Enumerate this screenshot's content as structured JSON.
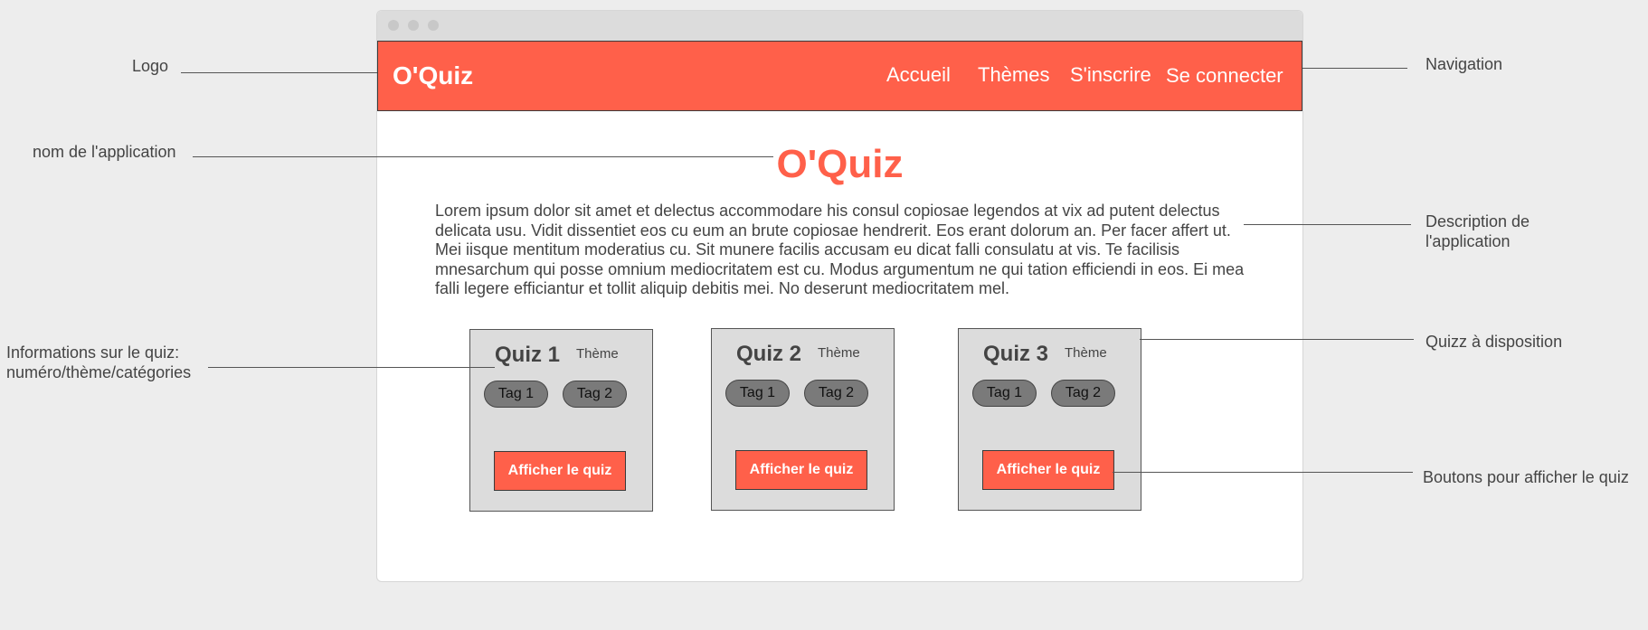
{
  "annotations": {
    "logo": "Logo",
    "app_name": "nom de l'application",
    "quiz_info_line1": "Informations sur le quiz:",
    "quiz_info_line2": "numéro/thème/catégories",
    "navigation": "Navigation",
    "description_line1": "Description de",
    "description_line2": "l'application",
    "quizzes": "Quizz à disposition",
    "buttons": "Boutons pour afficher le quiz"
  },
  "header": {
    "logo": "O'Quiz",
    "nav": [
      "Accueil",
      "Thèmes",
      "S'inscrire",
      "Se connecter"
    ]
  },
  "main": {
    "title": "O'Quiz",
    "description": "Lorem ipsum dolor sit amet et delectus accommodare his consul copiosae legendos at vix ad putent delectus delicata usu. Vidit dissentiet eos cu eum an brute copiosae hendrerit. Eos erant dolorum an. Per facer affert ut. Mei iisque mentitum moderatius cu. Sit munere facilis accusam eu dicat falli consulatu at vis. Te facilisis mnesarchum qui posse omnium mediocritatem est cu. Modus argumentum ne qui tation efficiendi in eos. Ei mea falli legere efficiantur et tollit aliquip debitis mei. No deserunt mediocritatem mel.",
    "quizzes": [
      {
        "title": "Quiz 1",
        "theme": "Thème",
        "tags": [
          "Tag 1",
          "Tag 2"
        ],
        "button": "Afficher le quiz"
      },
      {
        "title": "Quiz 2",
        "theme": "Thème",
        "tags": [
          "Tag 1",
          "Tag 2"
        ],
        "button": "Afficher le quiz"
      },
      {
        "title": "Quiz 3",
        "theme": "Thème",
        "tags": [
          "Tag 1",
          "Tag 2"
        ],
        "button": "Afficher le quiz"
      }
    ]
  },
  "colors": {
    "accent": "#ff604a",
    "card_bg": "#dcdcdc",
    "tag_bg": "#7a7a7a",
    "page_bg": "#ededed"
  }
}
